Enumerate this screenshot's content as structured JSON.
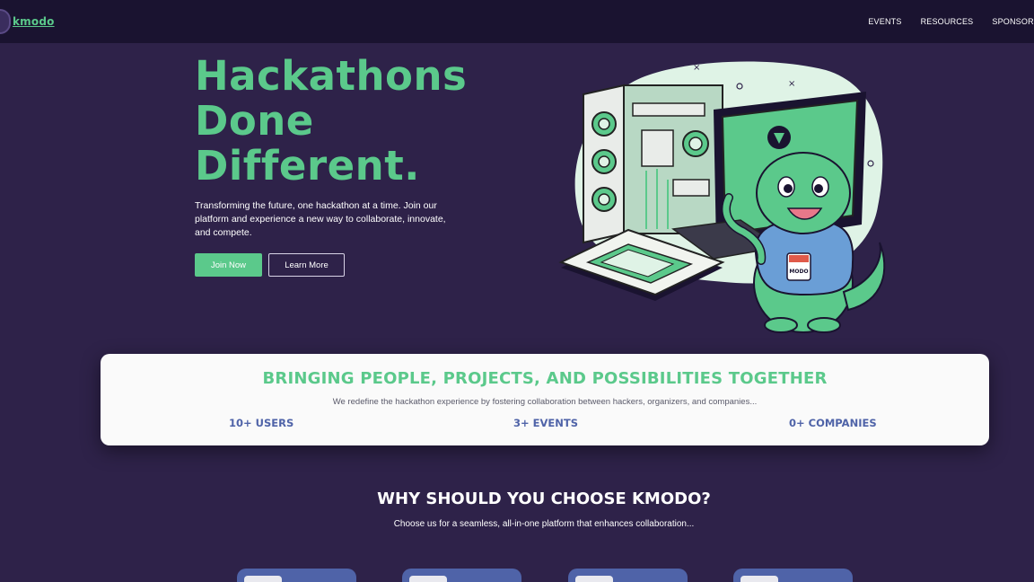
{
  "nav": {
    "logo_text": "kmodo",
    "links": [
      "EVENTS",
      "RESOURCES",
      "SPONSORS"
    ]
  },
  "hero": {
    "title_lines": [
      "Hackathons",
      "Done",
      "Different."
    ],
    "subtitle": "Transforming the future, one hackathon at a time. Join our platform and experience a new way to collaborate, innovate, and compete.",
    "join_label": "Join Now",
    "learn_label": "Learn More",
    "badge_text": "MODO"
  },
  "stats": {
    "title": "BRINGING PEOPLE, PROJECTS, AND POSSIBILITIES TOGETHER",
    "subtitle": "We redefine the hackathon experience by fostering collaboration between hackers, organizers, and companies...",
    "items": [
      "10+ USERS",
      "3+ EVENTS",
      "0+ COMPANIES"
    ]
  },
  "why": {
    "title": "WHY SHOULD YOU CHOOSE KMODO?",
    "subtitle": "Choose us for a seamless, all-in-one platform that enhances collaboration..."
  },
  "colors": {
    "background": "#2e2249",
    "nav": "#1a1330",
    "accent_green": "#5bc98b",
    "accent_blue": "#4f63a8",
    "card": "#fafafa"
  }
}
